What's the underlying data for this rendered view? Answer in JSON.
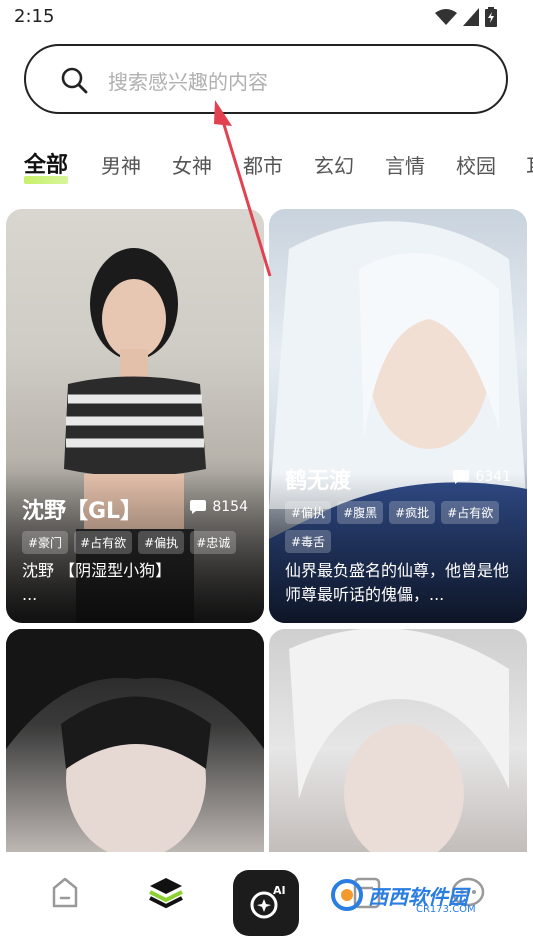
{
  "status": {
    "time": "2:15"
  },
  "search": {
    "placeholder": "搜索感兴趣的内容"
  },
  "tabs": [
    {
      "label": "全部",
      "active": true
    },
    {
      "label": "男神",
      "active": false
    },
    {
      "label": "女神",
      "active": false
    },
    {
      "label": "都市",
      "active": false
    },
    {
      "label": "玄幻",
      "active": false
    },
    {
      "label": "言情",
      "active": false
    },
    {
      "label": "校园",
      "active": false
    },
    {
      "label": "耳",
      "active": false
    }
  ],
  "cards": [
    {
      "name": "沈野【GL】",
      "count": "8154",
      "tags": [
        "#豪门",
        "#占有欲",
        "#偏执",
        "#忠诚"
      ],
      "desc": "沈野 【阴湿型小狗】",
      "desc_more": "..."
    },
    {
      "name": "鹤无渡",
      "count": "6341",
      "tags": [
        "#偏执",
        "#腹黑",
        "#疯批",
        "#占有欲",
        "#毒舌"
      ],
      "desc": "仙界最负盛名的仙尊，他曾是他师尊最听话的傀儡，..."
    },
    {
      "name": "",
      "count": "",
      "tags": [],
      "desc": ""
    },
    {
      "name": "",
      "count": "",
      "tags": [],
      "desc": ""
    }
  ],
  "bottom_nav": [
    {
      "icon": "home-icon"
    },
    {
      "icon": "layers-icon"
    },
    {
      "icon": "ai-sparkle-icon",
      "label": "AI"
    },
    {
      "icon": "document-icon"
    },
    {
      "icon": "chat-icon"
    }
  ],
  "watermark": {
    "text": "西西软件园",
    "sub": "CR173.COM"
  },
  "colors": {
    "accent": "#c8f06a",
    "dark": "#1c1c1c",
    "arrow": "#e2424f"
  }
}
